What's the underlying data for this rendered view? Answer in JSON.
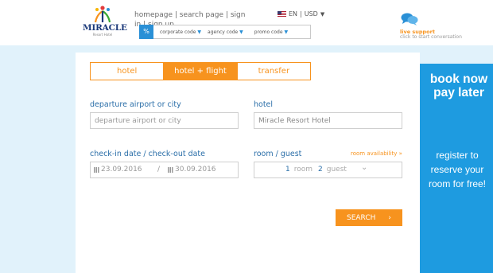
{
  "brand": {
    "name": "MIRACLE",
    "tagline": "Resort Hotel"
  },
  "nav": {
    "homepage": "homepage",
    "search_page": "search page",
    "sign_in": "sign in",
    "sign_up": "sign up",
    "sep": "|"
  },
  "locale": {
    "language": "EN",
    "currency": "USD",
    "sep": "|"
  },
  "codes": {
    "icon": "%",
    "corporate": "corporate code",
    "agency": "agency code",
    "promo": "promo code"
  },
  "support": {
    "title": "live support",
    "subtitle": "click to start conversation"
  },
  "tabs": [
    {
      "label": "hotel",
      "active": false
    },
    {
      "label": "hotel + flight",
      "active": true
    },
    {
      "label": "transfer",
      "active": false
    }
  ],
  "form": {
    "departure_label": "departure airport or city",
    "departure_placeholder": "departure airport or city",
    "hotel_label": "hotel",
    "hotel_value": "Miracle Resort Hotel",
    "dates_label": "check-in date / check-out date",
    "checkin": "23.09.2016",
    "date_sep": "/",
    "checkout": "30.09.2016",
    "room_guest_label": "room / guest",
    "room_availability": "room availability »",
    "rooms": "1",
    "room_word": "room",
    "guests": "2",
    "guest_word": "guest",
    "search": "SEARCH"
  },
  "promo": {
    "headline": "book now pay later",
    "body": "register to reserve your room for free!"
  },
  "colors": {
    "accent": "#f7931e",
    "blue": "#1e9be0",
    "label": "#2a6ea8",
    "background": "#e1f2fb"
  }
}
